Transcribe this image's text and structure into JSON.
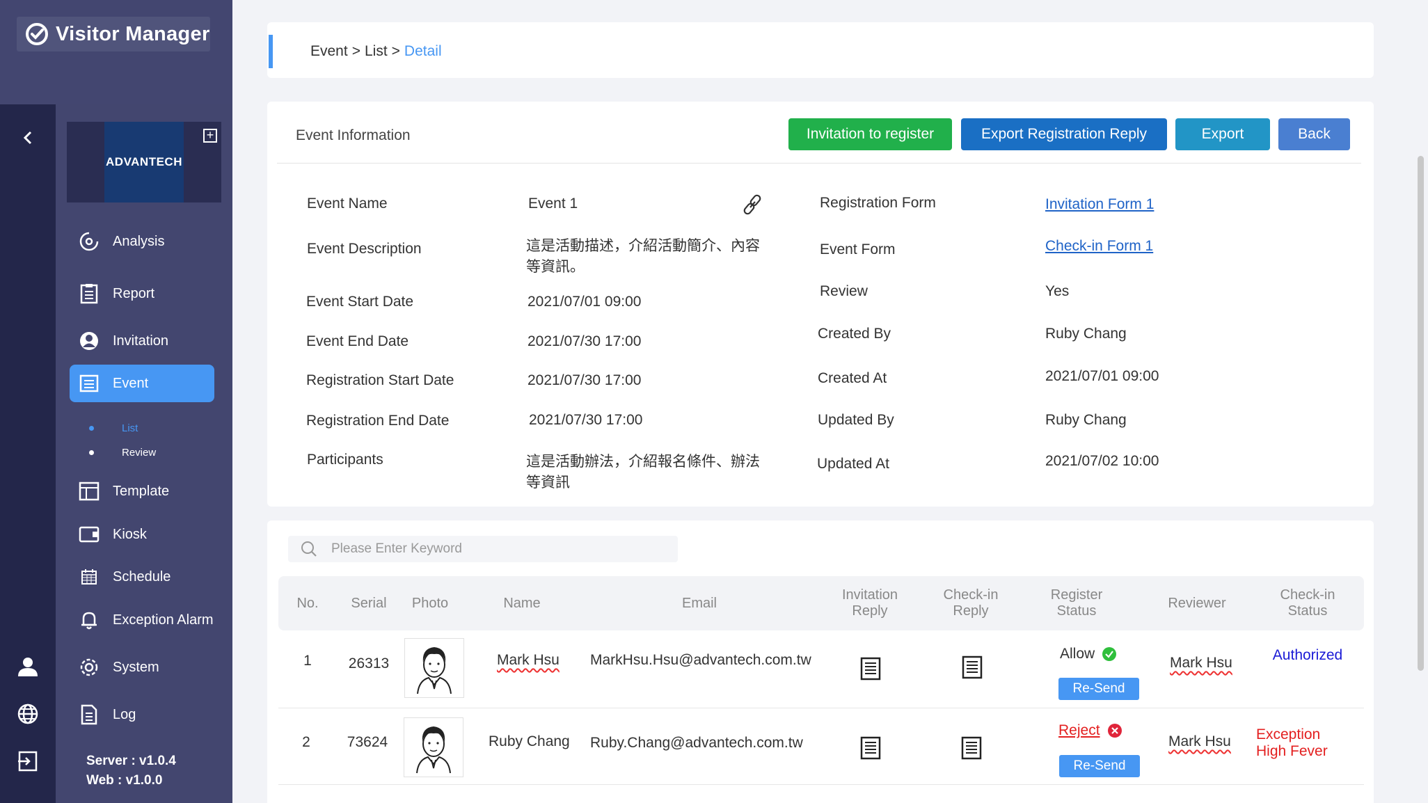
{
  "app": {
    "title": "Visitor Manager"
  },
  "company": {
    "name": "ADVANTECH"
  },
  "sidebar": {
    "items": [
      {
        "label": "Analysis"
      },
      {
        "label": "Report"
      },
      {
        "label": "Invitation"
      },
      {
        "label": "Event"
      },
      {
        "label": "Template"
      },
      {
        "label": "Kiosk"
      },
      {
        "label": "Schedule"
      },
      {
        "label": "Exception Alarm"
      },
      {
        "label": "System"
      },
      {
        "label": "Log"
      }
    ],
    "event_sub": [
      {
        "label": "List"
      },
      {
        "label": "Review"
      }
    ],
    "version_server": "Server : v1.0.4",
    "version_web": "Web : v1.0.0"
  },
  "breadcrumb": {
    "level1": "Event",
    "sep": ">",
    "level2": "List",
    "current": "Detail"
  },
  "info": {
    "title": "Event Information",
    "buttons": {
      "invite": "Invitation to register",
      "export_reply": "Export Registration Reply",
      "export": "Export",
      "back": "Back"
    },
    "left": {
      "event_name_label": "Event Name",
      "event_name": "Event 1",
      "desc_label": "Event Description",
      "desc_line1": "這是活動描述，介紹活動簡介、內容",
      "desc_line2": "等資訊。",
      "start_label": "Event Start Date",
      "start": "2021/07/01 09:00",
      "end_label": "Event End Date",
      "end": "2021/07/30 17:00",
      "reg_start_label": "Registration Start Date",
      "reg_start": "2021/07/30 17:00",
      "reg_end_label": "Registration End Date",
      "reg_end": "2021/07/30 17:00",
      "participants_label": "Participants",
      "participants_line1": "這是活動辦法，介紹報名條件、辦法",
      "participants_line2": "等資訊"
    },
    "right": {
      "reg_form_label": "Registration Form",
      "reg_form": "Invitation Form 1",
      "event_form_label": "Event Form",
      "event_form": "Check-in Form 1",
      "review_label": "Review",
      "review": "Yes",
      "created_by_label": "Created By",
      "created_by": "Ruby Chang",
      "created_at_label": "Created At",
      "created_at": "2021/07/01 09:00",
      "updated_by_label": "Updated By",
      "updated_by": "Ruby Chang",
      "updated_at_label": "Updated At",
      "updated_at": "2021/07/02 10:00"
    }
  },
  "search": {
    "placeholder": "Please Enter Keyword"
  },
  "table": {
    "headers": {
      "no": "No.",
      "serial": "Serial",
      "photo": "Photo",
      "name": "Name",
      "email": "Email",
      "inv_reply_1": "Invitation",
      "inv_reply_2": "Reply",
      "chk_reply_1": "Check-in",
      "chk_reply_2": "Reply",
      "reg_status_1": "Register",
      "reg_status_2": "Status",
      "reviewer": "Reviewer",
      "chk_status_1": "Check-in",
      "chk_status_2": "Status"
    },
    "rows": [
      {
        "no": "1",
        "serial": "26313",
        "name": "Mark Hsu",
        "email": "MarkHsu.Hsu@advantech.com.tw",
        "register_status": "Allow",
        "resend": "Re-Send",
        "reviewer": "Mark Hsu",
        "checkin_status_1": "Authorized",
        "checkin_status_2": ""
      },
      {
        "no": "2",
        "serial": "73624",
        "name": "Ruby Chang",
        "email": "Ruby.Chang@advantech.com.tw",
        "register_status": "Reject",
        "resend": "Re-Send",
        "reviewer": "Mark Hsu",
        "checkin_status_1": "Exception",
        "checkin_status_2": "High Fever"
      }
    ]
  },
  "colors": {
    "accent": "#4797f3",
    "invite_btn": "#21b04b",
    "export_reply_btn": "#1a6fc4",
    "export_btn": "#2295c6",
    "back_btn": "#4a7fd1",
    "authorized": "#1a1ad6",
    "exception": "#e32020",
    "allow_icon": "#2fbf3c",
    "reject_icon": "#e0253a"
  }
}
